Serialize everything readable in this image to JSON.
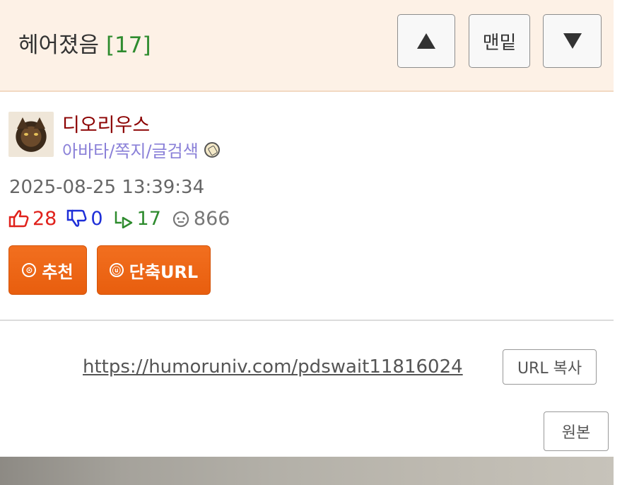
{
  "header": {
    "title": "헤어졌음",
    "comment_count": "[17]",
    "bottom_label": "맨밑"
  },
  "author": {
    "name": "디오리우스",
    "links": "아바타/쪽지/글검색"
  },
  "post": {
    "date": "2025-08-25 13:39:34",
    "upvotes": "28",
    "downvotes": "0",
    "replies": "17",
    "views": "866"
  },
  "actions": {
    "recommend_icon": "⊙",
    "recommend_label": "추천",
    "shorturl_icon": "ⓤ",
    "shorturl_label": "단축URL"
  },
  "share": {
    "url": "https://humoruniv.com/pdswait11816024",
    "copy_label": "URL 복사",
    "original_label": "원본"
  },
  "colors": {
    "header_bg": "#fdf1e6",
    "count_green": "#2e8b2e",
    "username_red": "#8b0000",
    "link_purple": "#8a80d8",
    "upvote_red": "#e0211b",
    "downvote_blue": "#1e2fd8",
    "orange_button": "#ee6614"
  }
}
